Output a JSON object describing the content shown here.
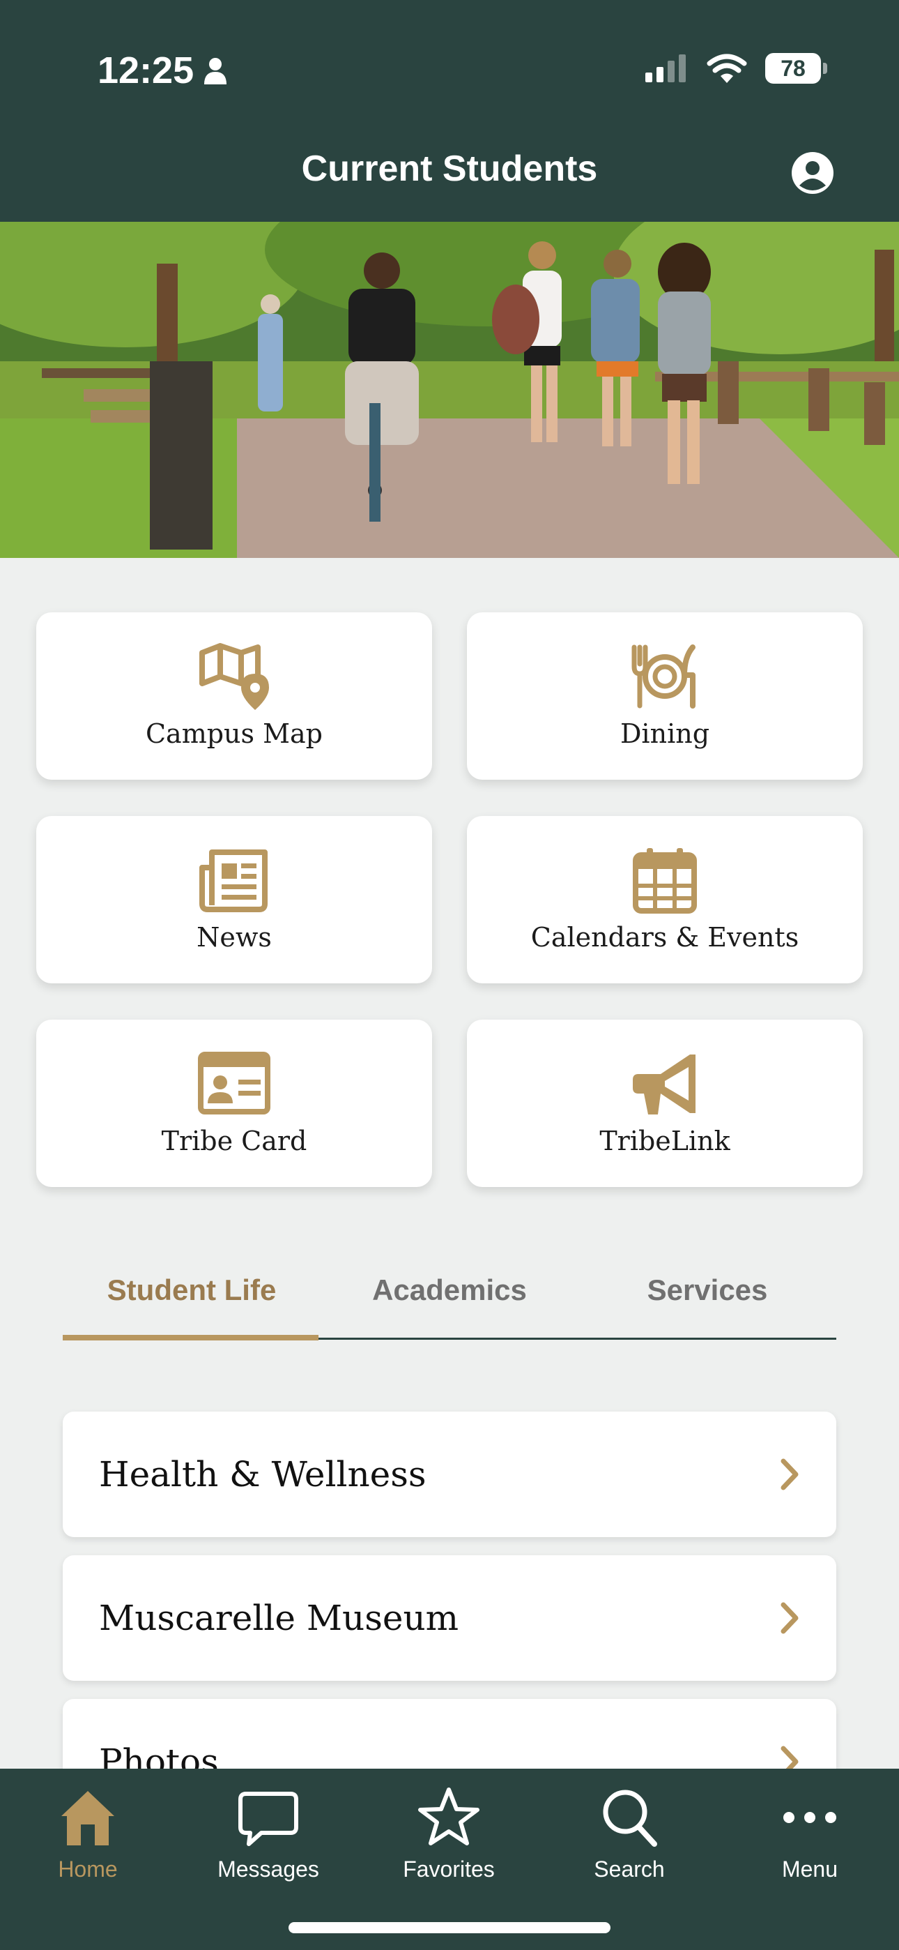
{
  "status_bar": {
    "time": "12:25",
    "battery": "78"
  },
  "header": {
    "title": "Current Students"
  },
  "hero": {
    "alt": "Students walking and cycling on campus path"
  },
  "tiles": [
    {
      "label": "Campus Map",
      "icon": "map-pin-icon"
    },
    {
      "label": "Dining",
      "icon": "dining-plate-icon"
    },
    {
      "label": "News",
      "icon": "newspaper-icon"
    },
    {
      "label": "Calendars & Events",
      "icon": "calendar-icon"
    },
    {
      "label": "Tribe Card",
      "icon": "id-card-icon"
    },
    {
      "label": "TribeLink",
      "icon": "megaphone-icon"
    }
  ],
  "tabs": [
    {
      "label": "Student Life"
    },
    {
      "label": "Academics"
    },
    {
      "label": "Services"
    }
  ],
  "active_tab": "Student Life",
  "list_items": [
    {
      "label": "Health & Wellness"
    },
    {
      "label": "Muscarelle Museum"
    },
    {
      "label": "Photos"
    }
  ],
  "tabbar": {
    "items": [
      {
        "label": "Home",
        "icon": "home-icon"
      },
      {
        "label": "Messages",
        "icon": "messages-icon"
      },
      {
        "label": "Favorites",
        "icon": "star-icon"
      },
      {
        "label": "Search",
        "icon": "search-icon"
      },
      {
        "label": "Menu",
        "icon": "more-icon"
      }
    ],
    "active": "Home"
  },
  "colors": {
    "primary_green": "#2a4440",
    "gold": "#b8975f",
    "gold_text": "#9a7b4f",
    "background": "#eef0ef"
  }
}
